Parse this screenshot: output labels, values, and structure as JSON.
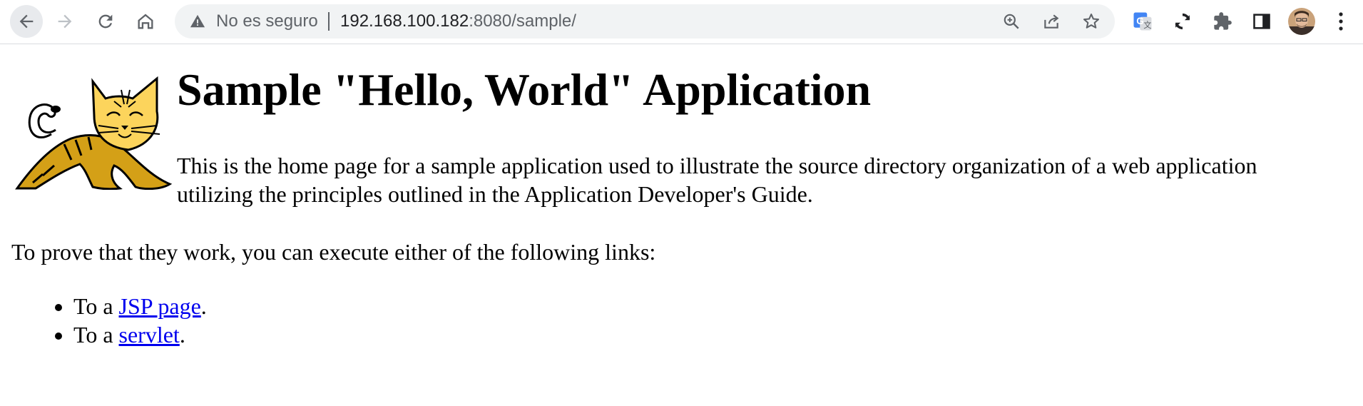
{
  "browser": {
    "back_icon": "arrow-left-icon",
    "forward_icon": "arrow-right-icon",
    "reload_icon": "reload-icon",
    "home_icon": "home-icon",
    "security_icon": "warning-triangle-icon",
    "security_label": "No es seguro",
    "url_host": "192.168.100.182",
    "url_rest": ":8080/sample/",
    "omnibox_actions": [
      "zoom-icon",
      "share-icon",
      "bookmark-star-icon"
    ],
    "extensions": [
      "google-translate-icon",
      "sync-extension-icon",
      "puzzle-extensions-icon"
    ],
    "side_panel_icon": "side-panel-icon",
    "profile_icon": "profile-avatar-icon",
    "menu_icon": "kebab-menu-icon"
  },
  "page": {
    "logo_icon": "tomcat-logo-icon",
    "heading": "Sample \"Hello, World\" Application",
    "intro": "This is the home page for a sample application used to illustrate the source directory organization of a web application utilizing the principles outlined in the Application Developer's Guide.",
    "prove_text": "To prove that they work, you can execute either of the following links:",
    "links": [
      {
        "prefix": "To a ",
        "link_text": "JSP page",
        "suffix": "."
      },
      {
        "prefix": "To a ",
        "link_text": "servlet",
        "suffix": "."
      }
    ]
  },
  "colors": {
    "link": "#0000ee",
    "omnibox_bg": "#f1f3f4",
    "icon_gray": "#5f6368",
    "tomcat_body": "#d4a017"
  }
}
